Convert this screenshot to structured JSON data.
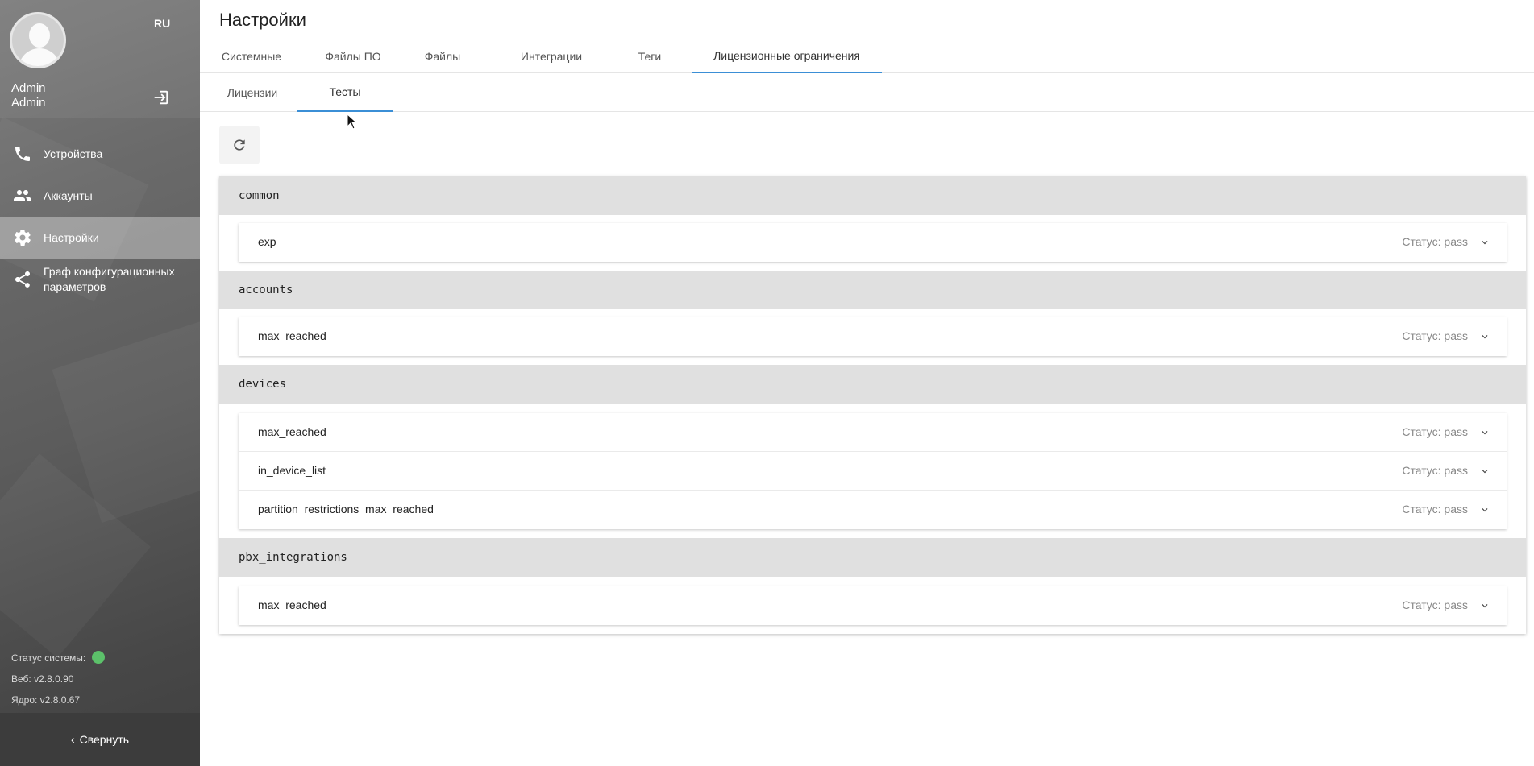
{
  "sidebar": {
    "lang": "RU",
    "user_first": "Admin",
    "user_last": "Admin",
    "nav": [
      {
        "label": "Устройства",
        "icon": "phone-icon"
      },
      {
        "label": "Аккаунты",
        "icon": "people-icon"
      },
      {
        "label": "Настройки",
        "icon": "gear-icon",
        "active": true
      },
      {
        "label": "Граф конфигурационных параметров",
        "icon": "share-icon"
      }
    ],
    "status_label": "Статус системы:",
    "status_color": "#5cc16a",
    "web_version": "Веб: v2.8.0.90",
    "core_version": "Ядро: v2.8.0.67",
    "collapse_label": "Свернуть"
  },
  "page": {
    "title": "Настройки",
    "tabs": [
      "Системные",
      "Файлы ПО",
      "Файлы",
      "Интеграции",
      "Теги",
      "Лицензионные ограничения"
    ],
    "active_tab": "Лицензионные ограничения",
    "subtabs": [
      "Лицензии",
      "Тесты"
    ],
    "active_subtab": "Тесты",
    "accent": "#3b8fd6"
  },
  "groups": [
    {
      "name": "common",
      "tests": [
        {
          "name": "exp",
          "status": "Статус: pass"
        }
      ]
    },
    {
      "name": "accounts",
      "tests": [
        {
          "name": "max_reached",
          "status": "Статус: pass"
        }
      ]
    },
    {
      "name": "devices",
      "tests": [
        {
          "name": "max_reached",
          "status": "Статус: pass"
        },
        {
          "name": "in_device_list",
          "status": "Статус: pass"
        },
        {
          "name": "partition_restrictions_max_reached",
          "status": "Статус: pass"
        }
      ]
    },
    {
      "name": "pbx_integrations",
      "tests": [
        {
          "name": "max_reached",
          "status": "Статус: pass"
        }
      ]
    }
  ]
}
